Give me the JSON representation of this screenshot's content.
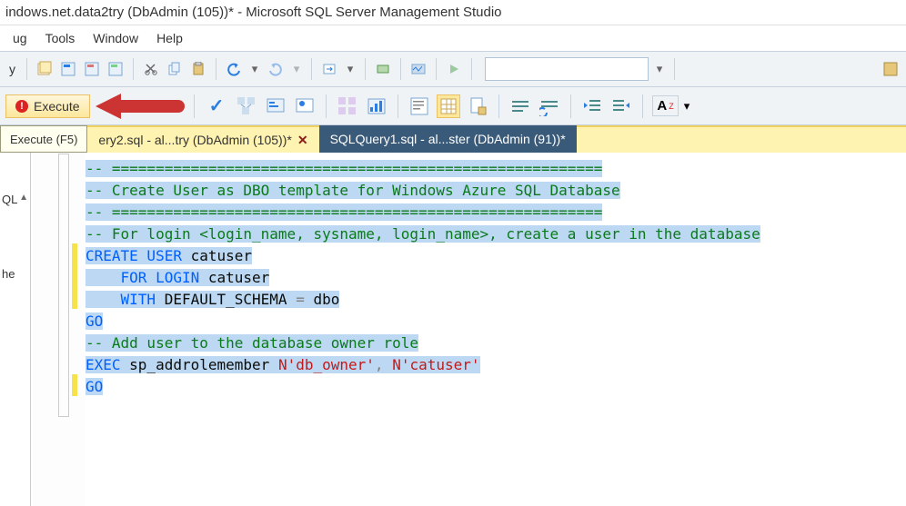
{
  "title": "indows.net.data2try (DbAdmin (105))* - Microsoft SQL Server Management Studio",
  "menu": {
    "ug": "ug",
    "tools": "Tools",
    "window": "Window",
    "help": "Help"
  },
  "toolbar1": {
    "leading_y": "y"
  },
  "toolbar2": {
    "execute": "Execute",
    "font_label": "A",
    "font_sub": "Z"
  },
  "tooltip": "Execute (F5)",
  "tabs": {
    "active": "ery2.sql - al...try (DbAdmin (105))*",
    "inactive": "SQLQuery1.sql - al...ster (DbAdmin (91))*"
  },
  "leftpane": {
    "sql": "QL",
    "he": "he"
  },
  "code": {
    "l1_sep": "-- ========================================================",
    "l2": "-- Create User as DBO template for Windows Azure SQL Database",
    "l3_sep": "-- ========================================================",
    "l4": "-- For login <login_name, sysname, login_name>, create a user in the database",
    "l5a": "CREATE",
    "l5b": " USER",
    "l5c": " catuser",
    "l6a": "    FOR",
    "l6b": " LOGIN",
    "l6c": " catuser",
    "l7a": "    WITH",
    "l7b": " DEFAULT_SCHEMA",
    "l7c": " ",
    "l7d": "=",
    "l7e": " dbo",
    "l8": "GO",
    "l9": "",
    "l10": "-- Add user to the database owner role",
    "l11a": "EXEC",
    "l11b": " sp_addrolemember",
    "l11c": " ",
    "l11d": "N'db_owner'",
    "l11e": ",",
    "l11f": " ",
    "l11g": "N'catuser'",
    "l12": "GO"
  }
}
